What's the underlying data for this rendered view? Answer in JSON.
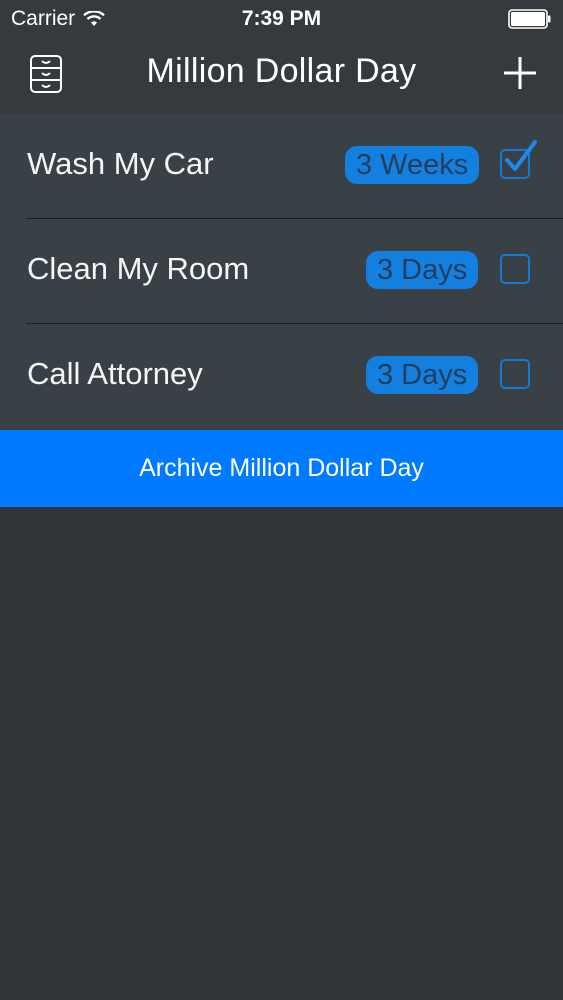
{
  "status_bar": {
    "carrier": "Carrier",
    "time": "7:39 PM"
  },
  "nav": {
    "title": "Million Dollar Day",
    "left_icon": "archive-drawer-icon",
    "right_icon": "plus-icon"
  },
  "tasks": [
    {
      "label": "Wash My Car",
      "due": "3 Weeks",
      "checked": true
    },
    {
      "label": "Clean My Room",
      "due": "3 Days",
      "checked": false
    },
    {
      "label": "Call Attorney",
      "due": "3 Days",
      "checked": false
    }
  ],
  "archive_button": {
    "label": "Archive Million Dollar Day"
  },
  "colors": {
    "accent": "#007aff",
    "badge": "#1380e0",
    "background": "#303438",
    "list_background": "#3a4146"
  }
}
